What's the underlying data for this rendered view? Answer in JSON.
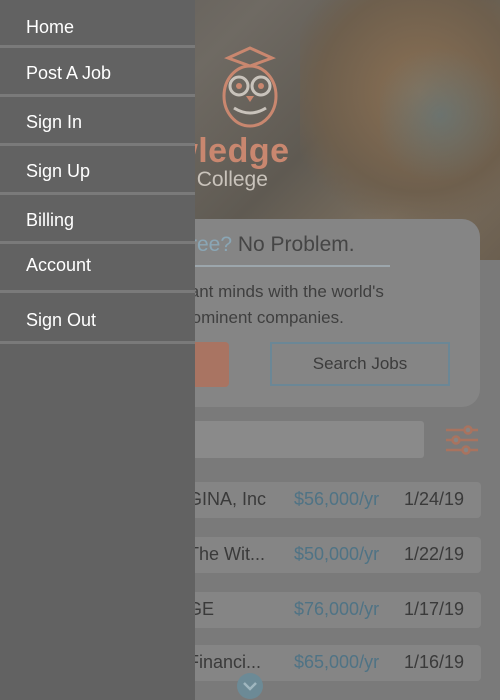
{
  "hero": {
    "logo_word": "owledge",
    "logo_sub": "hout College"
  },
  "card": {
    "title_accent": "ree?",
    "title_rest": "No Problem.",
    "body_line1": "iant minds with the world's",
    "body_line2": "rominent companies.",
    "search_button": "Search Jobs"
  },
  "jobs": [
    {
      "company": "GINA, Inc",
      "salary": "$56,000/yr",
      "date": "1/24/19"
    },
    {
      "company": "The Wit...",
      "salary": "$50,000/yr",
      "date": "1/22/19"
    },
    {
      "company": "GE",
      "salary": "$76,000/yr",
      "date": "1/17/19"
    },
    {
      "company": "Financi...",
      "salary": "$65,000/yr",
      "date": "1/16/19"
    }
  ],
  "drawer": {
    "items": [
      {
        "label": "Home"
      },
      {
        "label": "Post A Job"
      },
      {
        "label": "Sign In"
      },
      {
        "label": "Sign Up"
      },
      {
        "label": "Billing"
      },
      {
        "label": "Account"
      },
      {
        "label": "Sign Out"
      }
    ]
  },
  "icons": {
    "logo": "owl-logo-icon",
    "filter": "filter-sliders-icon",
    "scroll": "chevron-down-icon"
  },
  "colors": {
    "drawer_bg": "#626262",
    "logo_accent": "#c9876f",
    "salary": "#4f7385",
    "accent_blue": "#8aa6b5"
  }
}
